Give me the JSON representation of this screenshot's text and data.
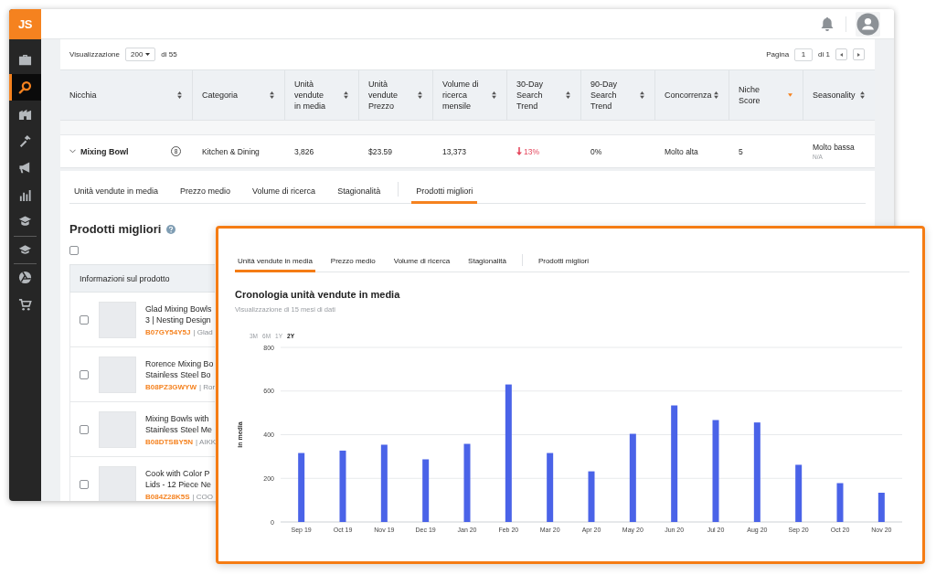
{
  "sidebar": {
    "logo": "JS",
    "groups": [
      {
        "items": [
          {
            "selected": false
          },
          {
            "selected": true
          },
          {
            "selected": false
          },
          {
            "selected": false
          },
          {
            "selected": false
          },
          {
            "selected": false
          },
          {
            "selected": false
          }
        ]
      },
      {
        "items": [
          {
            "selected": false
          }
        ]
      },
      {
        "items": [
          {
            "selected": false
          },
          {
            "selected": false
          }
        ]
      }
    ]
  },
  "toolbar": {
    "show_label": "Visualizzazione",
    "page_size": "200",
    "total": "di 55",
    "page_label": "Pagina",
    "page": "1",
    "page_total": "di 1"
  },
  "table": {
    "columns": [
      {
        "label": "Nicchia",
        "sorted": false
      },
      {
        "label": "Categoria",
        "sorted": false
      },
      {
        "label": "Unità vendute in media",
        "sorted": false
      },
      {
        "label": "Unità vendute Prezzo",
        "sorted": false
      },
      {
        "label": "Volume di ricerca mensile",
        "sorted": false
      },
      {
        "label": "30-Day Search Trend",
        "sorted": false
      },
      {
        "label": "90-Day Search Trend",
        "sorted": false
      },
      {
        "label": "Concorrenza",
        "sorted": false
      },
      {
        "label": "Niche Score",
        "sorted": true
      },
      {
        "label": "Seasonality",
        "sorted": false
      }
    ],
    "rows": [
      {
        "expanded": true,
        "niche": "Mixing Bowl",
        "count": "8",
        "category": "Kitchen & Dining",
        "avg_units": "3,826",
        "price": "$23.59",
        "search_volume": "13,373",
        "trend_30": {
          "kind": "down",
          "value": "13%"
        },
        "trend_90": {
          "kind": "flat",
          "value": "0%"
        },
        "competition": "Molto alta",
        "niche_score": "5",
        "seasonality": "Molto bassa",
        "seasonality_note": "N/A"
      }
    ]
  },
  "detail_tabs": [
    {
      "label": "Unità vendute in media",
      "selected": false
    },
    {
      "label": "Prezzo medio",
      "selected": false
    },
    {
      "label": "Volume di ricerca",
      "selected": false
    },
    {
      "label": "Stagionalità",
      "selected": false
    },
    {
      "label": "Prodotti migliori",
      "selected": true
    }
  ],
  "top_products": {
    "title": "Prodotti migliori",
    "select_all_checked": false,
    "column": "Informazioni sul prodotto",
    "rows": [
      {
        "checked": false,
        "title_lines": [
          "Glad Mixing Bowls",
          "3 | Nesting Design"
        ],
        "asin": "B07GY54Y5J",
        "brand": "| Glad"
      },
      {
        "checked": false,
        "title_lines": [
          "Rorence Mixing Bo",
          "Stainless Steel Bo"
        ],
        "asin": "B08PZ3GWYW",
        "brand": "| Ror"
      },
      {
        "checked": false,
        "title_lines": [
          "Mixing Bowls with",
          "Stainless Steel Me"
        ],
        "asin": "B08DTSBY5N",
        "brand": "| AIKK"
      },
      {
        "checked": false,
        "title_lines": [
          "Cook with Color P",
          "Lids - 12 Piece Ne"
        ],
        "asin": "B084Z28K5S",
        "brand": "| COO"
      }
    ]
  },
  "overlay": {
    "tabs": [
      {
        "label": "Unità vendute in media",
        "selected": true
      },
      {
        "label": "Prezzo medio",
        "selected": false
      },
      {
        "label": "Volume di ricerca",
        "selected": false
      },
      {
        "label": "Stagionalità",
        "selected": false
      },
      {
        "label": "Prodotti migliori",
        "selected": false
      }
    ],
    "title": "Cronologia unità vendute in media",
    "subtitle": "Visualizzazione di 15 mesi di dati",
    "ranges": [
      {
        "label": "3M",
        "selected": false
      },
      {
        "label": "6M",
        "selected": false
      },
      {
        "label": "1Y",
        "selected": false
      },
      {
        "label": "2Y",
        "selected": true
      }
    ],
    "chart_data": {
      "type": "bar",
      "ylabel": "in media",
      "categories": [
        "Sep 19",
        "Oct 19",
        "Nov 19",
        "Dec 19",
        "Jan 20",
        "Feb 20",
        "Mar 20",
        "Apr 20",
        "May 20",
        "Jun 20",
        "Jul 20",
        "Aug 20",
        "Sep 20",
        "Oct 20",
        "Nov 20"
      ],
      "values": [
        316,
        327,
        354,
        287,
        358,
        630,
        316,
        232,
        404,
        534,
        467,
        456,
        262,
        178,
        134
      ],
      "ylim": [
        0,
        800
      ],
      "yticks": [
        0,
        200,
        400,
        600,
        800
      ],
      "grid": true
    }
  }
}
